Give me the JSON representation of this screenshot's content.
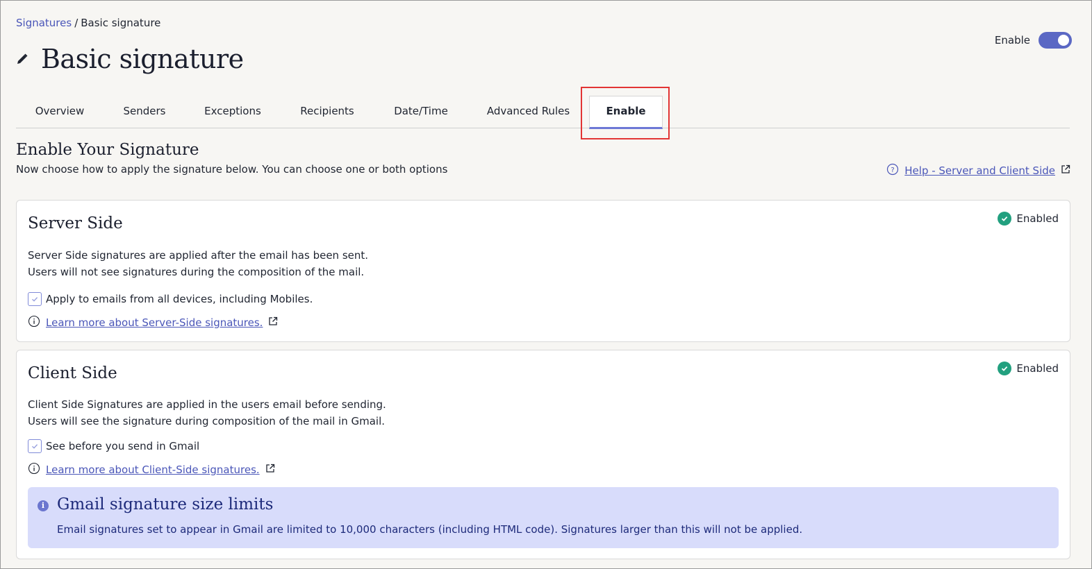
{
  "breadcrumb": {
    "root": "Signatures",
    "separator": "/",
    "current": "Basic signature"
  },
  "page": {
    "title": "Basic signature",
    "enable_label": "Enable",
    "enable_on": true
  },
  "tabs": [
    {
      "label": "Overview",
      "active": false
    },
    {
      "label": "Senders",
      "active": false
    },
    {
      "label": "Exceptions",
      "active": false
    },
    {
      "label": "Recipients",
      "active": false
    },
    {
      "label": "Date/Time",
      "active": false
    },
    {
      "label": "Advanced Rules",
      "active": false
    },
    {
      "label": "Enable",
      "active": true
    }
  ],
  "section": {
    "title": "Enable Your Signature",
    "subtitle": "Now choose how to apply the signature below. You can choose one or both options",
    "help_link": "Help - Server and Client Side"
  },
  "server_side": {
    "title": "Server Side",
    "status": "Enabled",
    "desc_line1": "Server Side signatures are applied after the email has been sent.",
    "desc_line2": "Users will not see signatures during the composition of the mail.",
    "checkbox_label": "Apply to emails from all devices, including Mobiles.",
    "checkbox_checked": true,
    "learn_more": "Learn more about Server-Side signatures."
  },
  "client_side": {
    "title": "Client Side",
    "status": "Enabled",
    "desc_line1": "Client Side Signatures are applied in the users email before sending.",
    "desc_line2": "Users will see the signature during composition of the mail in Gmail.",
    "checkbox_label": "See before you send in Gmail",
    "checkbox_checked": true,
    "learn_more": "Learn more about Client-Side signatures."
  },
  "notice": {
    "title": "Gmail signature size limits",
    "text": "Email signatures set to appear in Gmail are limited to 10,000 characters (including HTML code). Signatures larger than this will not be applied."
  },
  "colors": {
    "accent": "#5b68c4",
    "link": "#4a56b8",
    "success": "#22a07f",
    "notice_bg": "#d8dcfb",
    "highlight": "#e23434"
  }
}
